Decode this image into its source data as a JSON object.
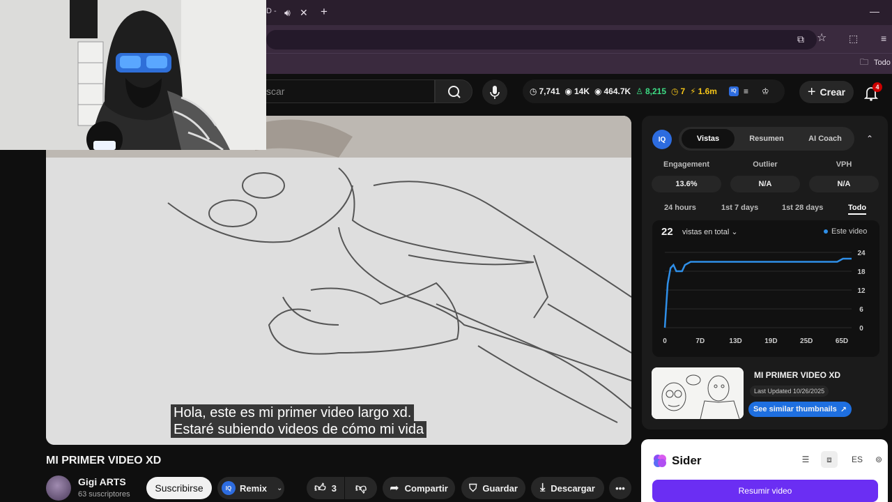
{
  "browser": {
    "tab_fragment": "D -",
    "bookmark_label": "Todo"
  },
  "header": {
    "search_placeholder": "scar",
    "stats": [
      {
        "icon": "clock-icon",
        "value": "7,741",
        "color": "#ffffff"
      },
      {
        "icon": "eye-icon",
        "value": "14K",
        "color": "#ffffff"
      },
      {
        "icon": "eye-icon",
        "value": "464.7K",
        "color": "#ffffff"
      },
      {
        "icon": "person-icon",
        "value": "8,215",
        "color": "#3ddc84"
      },
      {
        "icon": "clock-icon",
        "value": "7",
        "color": "#f5c518"
      },
      {
        "icon": "bolt-icon",
        "value": "1.6m",
        "color": "#f5c518"
      }
    ],
    "create_label": "Crear",
    "notifications_count": "4"
  },
  "video": {
    "caption_line1": "Hola, este es mi primer video largo xd.",
    "caption_line2": "Estaré subiendo videos de cómo mi vida",
    "title": "MI PRIMER VIDEO XD"
  },
  "channel": {
    "name": "Gigi ARTS",
    "subscribers": "63 suscriptores",
    "subscribe_label": "Suscribirse"
  },
  "actions": {
    "remix": "Remix",
    "likes": "3",
    "share": "Compartir",
    "save": "Guardar",
    "download": "Descargar"
  },
  "vidiq": {
    "logo": "IQ",
    "tabs": [
      "Vistas",
      "Resumen",
      "AI Coach"
    ],
    "metrics": [
      {
        "label": "Engagement",
        "value": "13.6%"
      },
      {
        "label": "Outlier",
        "value": "N/A"
      },
      {
        "label": "VPH",
        "value": "N/A"
      }
    ],
    "ranges": [
      "24 hours",
      "1st 7 days",
      "1st 28 days",
      "Todo"
    ],
    "views_total": "22",
    "views_select": "vistas en total",
    "legend": "Este video",
    "similar_title": "MI PRIMER VIDEO XD",
    "last_updated": "Last Updated 10/26/2025",
    "similar_button": "See similar thumbnails"
  },
  "chart_data": {
    "type": "line",
    "series": [
      {
        "name": "Este video",
        "color": "#2f8fe8"
      }
    ],
    "x_ticks": [
      "0",
      "7D",
      "13D",
      "19D",
      "25D",
      "65D"
    ],
    "y_ticks": [
      "24",
      "18",
      "12",
      "6",
      "0"
    ],
    "ylim": [
      0,
      24
    ],
    "points": [
      [
        0,
        0
      ],
      [
        1,
        14
      ],
      [
        2,
        19
      ],
      [
        3,
        20
      ],
      [
        4,
        18
      ],
      [
        6,
        18
      ],
      [
        7,
        20
      ],
      [
        9,
        21
      ],
      [
        11,
        21
      ],
      [
        14,
        21
      ],
      [
        20,
        21
      ],
      [
        30,
        21
      ],
      [
        40,
        21
      ],
      [
        50,
        21
      ],
      [
        60,
        21
      ],
      [
        62,
        22
      ],
      [
        65,
        22
      ]
    ],
    "xlim": [
      0,
      65
    ]
  },
  "sider": {
    "name": "Sider",
    "lang": "ES",
    "summarize": "Resumir video"
  }
}
